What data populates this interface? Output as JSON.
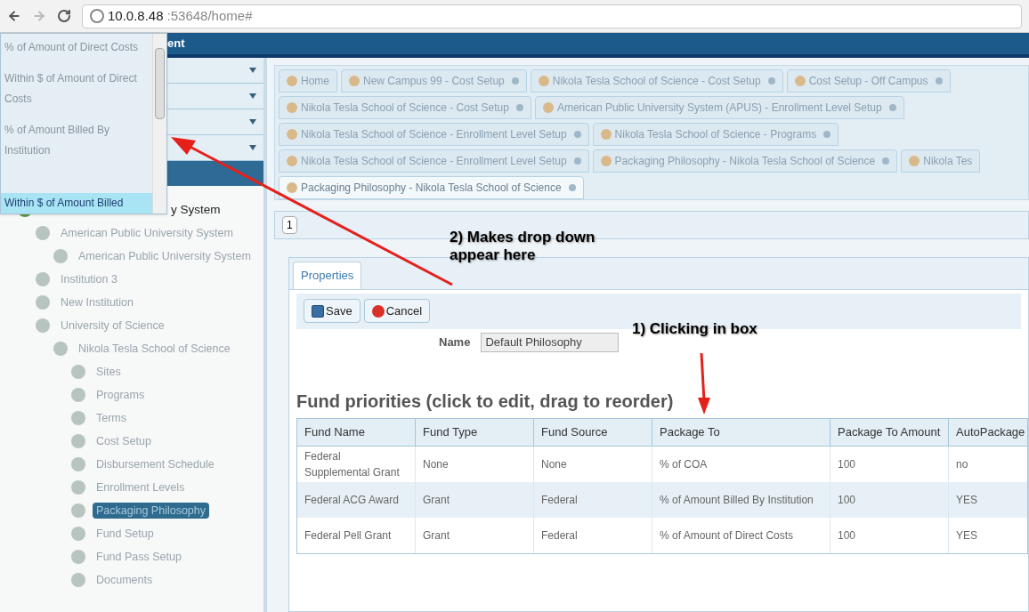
{
  "browser": {
    "url_host": "10.0.8.48",
    "url_rest": ":53648/home#"
  },
  "app_header": {
    "title_fragment": "ent"
  },
  "dropdown": {
    "options": [
      {
        "label": "% of Amount of Direct Costs",
        "selected": false
      },
      {
        "label": "Within $ of Amount of Direct Costs",
        "selected": false
      },
      {
        "label": "% of Amount Billed By Institution",
        "selected": false
      },
      {
        "label": "Within $ of Amount Billed",
        "selected": true
      }
    ]
  },
  "sidebar": {
    "sections": [
      {
        "expanded": false
      },
      {
        "expanded": false
      },
      {
        "expanded": false
      },
      {
        "expanded": false
      }
    ],
    "tree": [
      {
        "label": "y System",
        "selected": false,
        "children": [
          {
            "label": "American Public University System",
            "selected": false,
            "children": [
              {
                "label": "American Public University System",
                "selected": false
              }
            ]
          },
          {
            "label": "Institution 3",
            "selected": false
          },
          {
            "label": "New Institution",
            "selected": false
          },
          {
            "label": "University of Science",
            "selected": false,
            "children": [
              {
                "label": "Nikola Tesla School of Science",
                "selected": false,
                "children": [
                  {
                    "label": "Sites",
                    "selected": false
                  },
                  {
                    "label": "Programs",
                    "selected": false
                  },
                  {
                    "label": "Terms",
                    "selected": false
                  },
                  {
                    "label": "Cost Setup",
                    "selected": false
                  },
                  {
                    "label": "Disbursement Schedule",
                    "selected": false
                  },
                  {
                    "label": "Enrollment Levels",
                    "selected": false
                  },
                  {
                    "label": "Packaging Philosophy",
                    "selected": true
                  },
                  {
                    "label": "Fund Setup",
                    "selected": false
                  },
                  {
                    "label": "Fund Pass Setup",
                    "selected": false
                  },
                  {
                    "label": "Documents",
                    "selected": false
                  }
                ]
              }
            ]
          }
        ]
      }
    ]
  },
  "tab_rows": [
    [
      {
        "label": "Home",
        "selected": false,
        "closable": false
      },
      {
        "label": "New Campus 99 - Cost Setup",
        "selected": false,
        "closable": true
      },
      {
        "label": "Nikola Tesla School of Science - Cost Setup",
        "selected": false,
        "closable": true
      },
      {
        "label": "Cost Setup - Off Campus",
        "selected": false,
        "closable": true
      }
    ],
    [
      {
        "label": "Nikola Tesla School of Science - Cost Setup",
        "selected": false,
        "closable": true
      },
      {
        "label": "American Public University System (APUS) - Enrollment Level Setup",
        "selected": false,
        "closable": true
      }
    ],
    [
      {
        "label": "Nikola Tesla School of Science - Enrollment Level Setup",
        "selected": false,
        "closable": true
      },
      {
        "label": "Nikola Tesla School of Science - Programs",
        "selected": false,
        "closable": true
      }
    ],
    [
      {
        "label": "Nikola Tesla School of Science - Enrollment Level Setup",
        "selected": false,
        "closable": true
      },
      {
        "label": "Packaging Philosophy - Nikola Tesla School of Science",
        "selected": false,
        "closable": true
      },
      {
        "label": "Nikola Tes",
        "selected": false,
        "closable": false
      }
    ],
    [
      {
        "label": "Packaging Philosophy - Nikola Tesla School of Science",
        "selected": true,
        "closable": true
      }
    ]
  ],
  "pager": {
    "page": "1"
  },
  "panel_tabs": [
    {
      "label": "Properties",
      "selected": true
    }
  ],
  "toolbar": {
    "buttons": [
      {
        "label": "Save",
        "kind": "save"
      },
      {
        "label": "Cancel",
        "kind": "cancel"
      }
    ]
  },
  "form": {
    "name_label": "Name",
    "name_value": "Default Philosophy"
  },
  "fund_priorities": {
    "title": "Fund priorities (click to edit, drag to reorder)",
    "columns": [
      "Fund Name",
      "Fund Type",
      "Fund Source",
      "Package To",
      "Package To Amount",
      "AutoPackage"
    ],
    "rows": [
      {
        "selected": false,
        "cells": [
          "Federal Supplemental Grant",
          "None",
          "None",
          "% of COA",
          "100",
          "no"
        ]
      },
      {
        "selected": true,
        "cells": [
          "Federal ACG Award",
          "Grant",
          "Federal",
          "% of Amount Billed By Institution",
          "100",
          "YES"
        ]
      },
      {
        "selected": false,
        "cells": [
          "Federal Pell Grant",
          "Grant",
          "Federal",
          "% of Amount of Direct Costs",
          "100",
          "YES"
        ]
      }
    ]
  },
  "annotations": [
    {
      "text": "2) Makes drop down appear here"
    },
    {
      "text": "1) Clicking in box"
    }
  ]
}
